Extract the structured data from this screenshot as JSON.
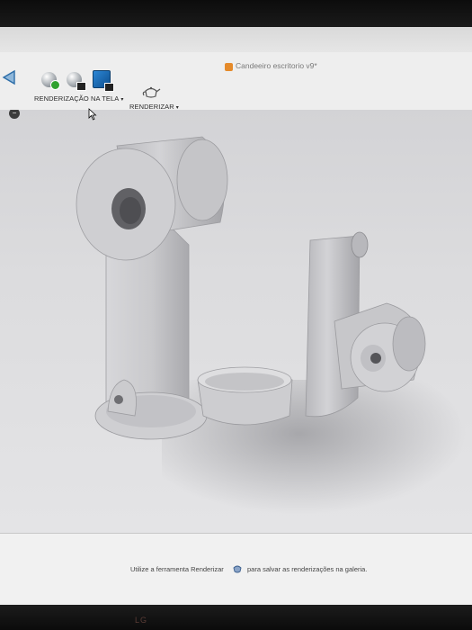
{
  "window": {
    "document_title": "Candeeiro escritorio v9*"
  },
  "toolbar": {
    "in_canvas_render_label": "RENDERIZAÇÃO NA TELA",
    "render_label": "RENDERIZAR",
    "caret": "▾"
  },
  "status": {
    "hint_before": "Utilize a ferramenta Renderizar",
    "hint_after": "para salvar as renderizações na galeria."
  },
  "monitor": {
    "brand": "LG"
  },
  "colors": {
    "accent_blue": "#1f6fb8",
    "model_gray": "#c8c8cb",
    "play_green": "#2fa12f"
  },
  "icons": {
    "in_canvas_start": "sphere-play-icon",
    "in_canvas_settings": "sphere-settings-icon",
    "capture_image": "capture-image-icon",
    "render": "teapot-icon"
  }
}
